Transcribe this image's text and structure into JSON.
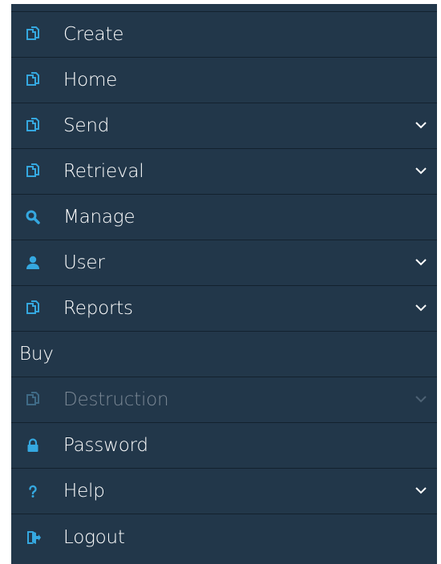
{
  "colors": {
    "menu_bg": "#22374a",
    "divider": "#13212e",
    "icon_accent": "#35a8e0",
    "text": "#ffffff",
    "disabled_text": "#7b8895"
  },
  "menu": {
    "items": [
      {
        "label": "Create",
        "icon": "documents-icon",
        "has_dropdown": false
      },
      {
        "label": "Home",
        "icon": "documents-icon",
        "has_dropdown": false
      },
      {
        "label": "Send",
        "icon": "documents-icon",
        "has_dropdown": true
      },
      {
        "label": "Retrieval",
        "icon": "documents-icon",
        "has_dropdown": true
      },
      {
        "label": "Manage",
        "icon": "search-icon",
        "has_dropdown": false
      },
      {
        "label": "User",
        "icon": "user-icon",
        "has_dropdown": true
      },
      {
        "label": "Reports",
        "icon": "documents-icon",
        "has_dropdown": true
      },
      {
        "label": "Buy",
        "icon": "",
        "has_dropdown": false
      },
      {
        "label": "Destruction",
        "icon": "documents-icon",
        "has_dropdown": true,
        "disabled": true
      },
      {
        "label": "Password",
        "icon": "lock-icon",
        "has_dropdown": false
      },
      {
        "label": "Help",
        "icon": "question-icon",
        "has_dropdown": true
      },
      {
        "label": "Logout",
        "icon": "logout-icon",
        "has_dropdown": false
      }
    ]
  }
}
